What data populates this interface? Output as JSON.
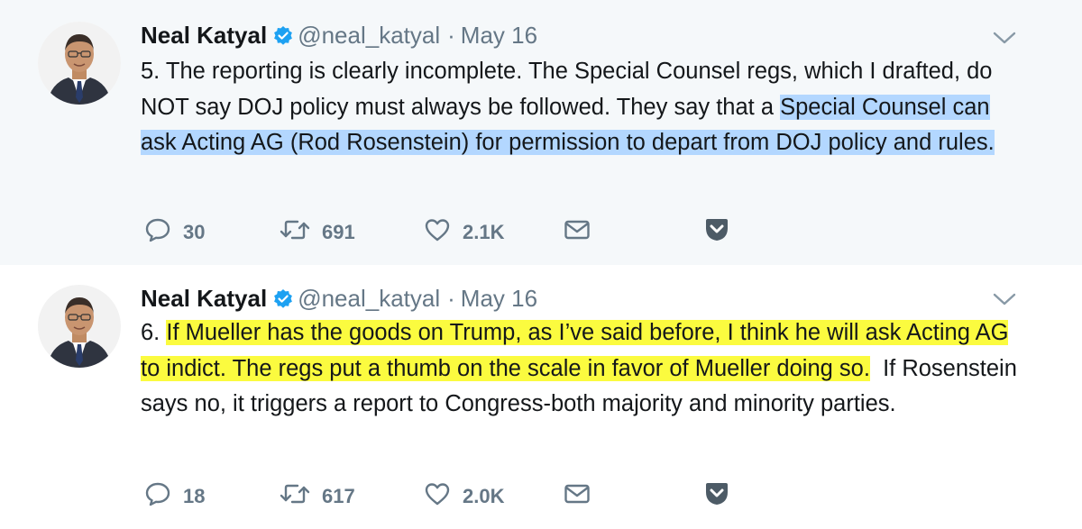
{
  "colors": {
    "thread_line": "#a4ebd2",
    "highlight_blue": "#b3d7ff",
    "highlight_yellow": "#fbfb3f",
    "verified": "#1da1f2",
    "muted": "#657786"
  },
  "icons": [
    "avatar",
    "verified-icon",
    "chevron-down-icon",
    "reply-icon",
    "retweet-icon",
    "like-icon",
    "direct-message-icon",
    "pocket-save-icon"
  ],
  "tweets": [
    {
      "author_name": "Neal Katyal",
      "handle": "@neal_katyal",
      "separator": "·",
      "date": "May 16",
      "text_parts": [
        "5. The reporting is clearly incomplete. The Special Counsel regs, which I drafted, do NOT say DOJ policy must always be followed. They say that a ",
        "Special Counsel can ask Acting AG (Rod Rosenstein) for permission to depart from DOJ policy and rules."
      ],
      "replies": "30",
      "retweets": "691",
      "likes": "2.1K"
    },
    {
      "author_name": "Neal Katyal",
      "handle": "@neal_katyal",
      "separator": "·",
      "date": "May 16",
      "text_parts": [
        "6. ",
        "If Mueller has the goods on Trump, as I’ve said before, I think he will ask Acting AG to indict.  The regs put a thumb on the scale in favor of Mueller doing so.",
        "  If Rosenstein says no, it triggers a report to Congress-both majority and minority parties."
      ],
      "replies": "18",
      "retweets": "617",
      "likes": "2.0K"
    }
  ]
}
